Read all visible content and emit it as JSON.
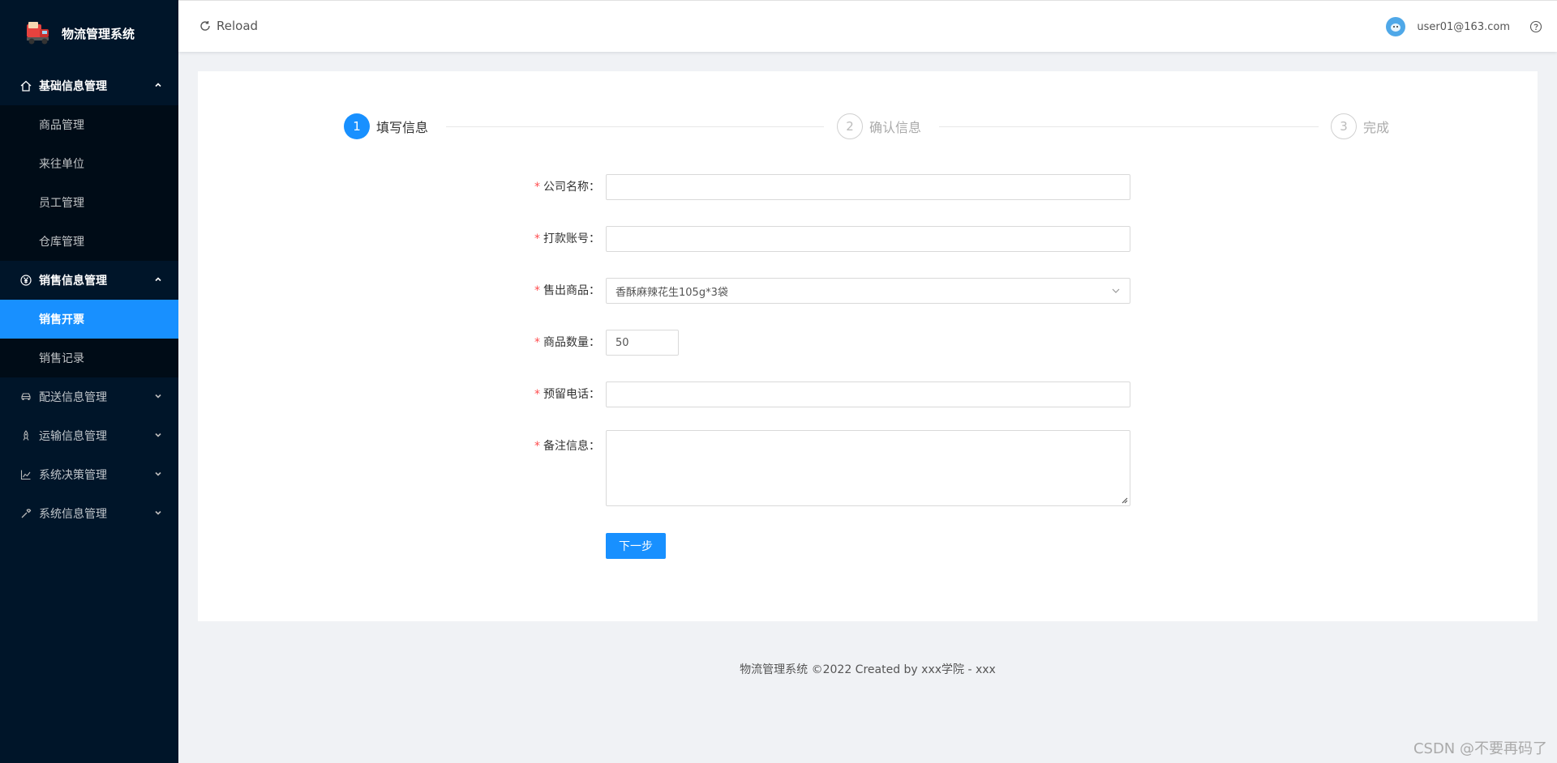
{
  "app": {
    "title": "物流管理系统"
  },
  "sidebar": {
    "groups": [
      {
        "label": "基础信息管理",
        "icon": "home-icon",
        "expanded": true,
        "items": [
          {
            "label": "商品管理"
          },
          {
            "label": "来往单位"
          },
          {
            "label": "员工管理"
          },
          {
            "label": "仓库管理"
          }
        ]
      },
      {
        "label": "销售信息管理",
        "icon": "yen-circle-icon",
        "expanded": true,
        "items": [
          {
            "label": "销售开票",
            "active": true
          },
          {
            "label": "销售记录"
          }
        ]
      },
      {
        "label": "配送信息管理",
        "icon": "car-icon",
        "expanded": false
      },
      {
        "label": "运输信息管理",
        "icon": "rocket-icon",
        "expanded": false
      },
      {
        "label": "系统决策管理",
        "icon": "line-chart-icon",
        "expanded": false
      },
      {
        "label": "系统信息管理",
        "icon": "wrench-icon",
        "expanded": false
      }
    ]
  },
  "header": {
    "reload_label": "Reload",
    "user_email": "user01@163.com"
  },
  "steps": [
    {
      "number": "1",
      "title": "填写信息",
      "status": "active"
    },
    {
      "number": "2",
      "title": "确认信息",
      "status": "wait"
    },
    {
      "number": "3",
      "title": "完成",
      "status": "wait"
    }
  ],
  "form": {
    "company": {
      "label": "公司名称",
      "value": ""
    },
    "account": {
      "label": "打款账号",
      "value": ""
    },
    "product": {
      "label": "售出商品",
      "value": "香酥麻辣花生105g*3袋"
    },
    "quantity": {
      "label": "商品数量",
      "value": "50"
    },
    "phone": {
      "label": "预留电话",
      "value": ""
    },
    "remark": {
      "label": "备注信息",
      "value": ""
    },
    "required_mark": "*",
    "label_suffix": "：",
    "next_label": "下一步"
  },
  "footer": {
    "text": "物流管理系统 ©2022 Created by xxx学院 - xxx"
  },
  "watermark": "CSDN @不要再码了",
  "colors": {
    "primary": "#1890ff",
    "sidebar_bg": "#001529",
    "submenu_bg": "#000c17",
    "required": "#ff4d4f"
  }
}
